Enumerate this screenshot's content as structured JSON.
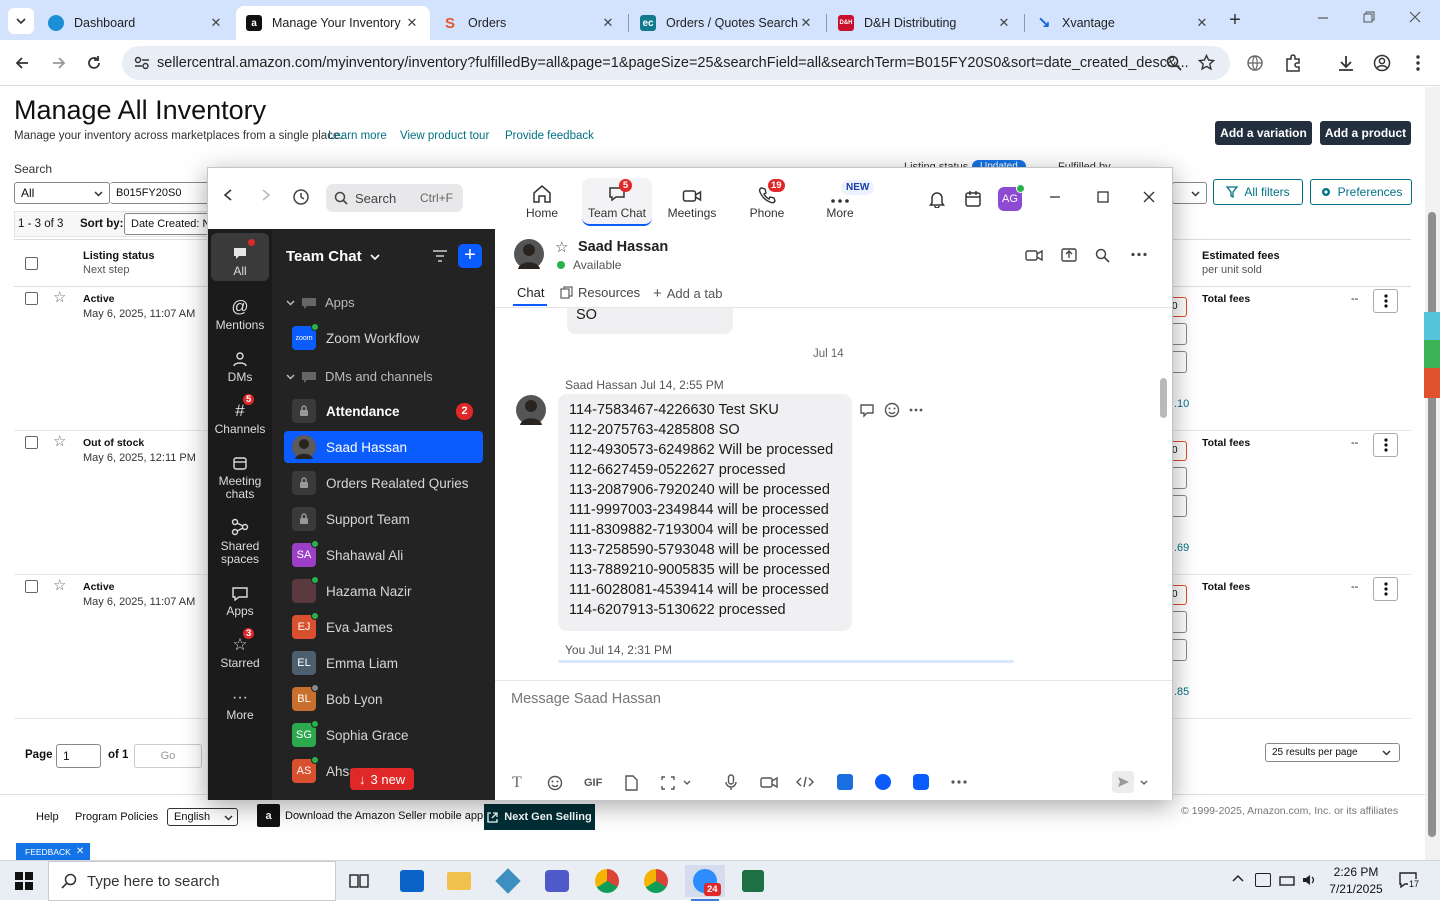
{
  "browser": {
    "tabs": [
      {
        "title": "Dashboard"
      },
      {
        "title": "Manage Your Inventory"
      },
      {
        "title": "Orders"
      },
      {
        "title": "Orders / Quotes Search"
      },
      {
        "title": "D&H Distributing"
      },
      {
        "title": "Xvantage"
      }
    ],
    "url": "sellercentral.amazon.com/myinventory/inventory?fulfilledBy=all&page=1&pageSize=25&searchField=all&searchTerm=B015FY20S0&sort=date_created_desc&..."
  },
  "amazon": {
    "title": "Manage All Inventory",
    "subtitle": "Manage your inventory across marketplaces from a single place.",
    "links": [
      "Learn more",
      "View product tour",
      "Provide feedback"
    ],
    "add_variation": "Add a variation",
    "add_product": "Add a product",
    "search_label": "Search",
    "search_scope": "All",
    "search_term": "B015FY20S0",
    "listing_status_partial": "Listing status",
    "updated_badge": "Updated",
    "fulfilled_by_partial": "Fulfilled by",
    "all_filters": "All filters",
    "preferences": "Preferences",
    "results_count": "1 - 3 of 3",
    "sort_by": "Sort by:",
    "sort_value": "Date Created: Ne",
    "col_listing_status": "Listing status",
    "col_next_step": "Next step",
    "col_est_fees": "Estimated fees",
    "col_per_unit": "per unit sold",
    "rows": [
      {
        "status": "Active",
        "date": "May 6, 2025, 11:07 AM",
        "fees": "Total fees",
        "dash": "--",
        "partial": ".10"
      },
      {
        "status": "Out of stock",
        "date": "May 6, 2025, 12:11 PM",
        "fees": "Total fees",
        "dash": "--",
        "partial": ".69"
      },
      {
        "status": "Active",
        "date": "May 6, 2025, 11:07 AM",
        "fees": "Total fees",
        "dash": "--",
        "partial": ".85"
      }
    ],
    "page_label": "Page",
    "page_value": "1",
    "of_label": "of 1",
    "go": "Go",
    "per_page": "25 results per page",
    "footer_help": "Help",
    "footer_policies": "Program Policies",
    "footer_lang": "English",
    "footer_app": "Download the Amazon Seller mobile app",
    "footer_ngs": "Next Gen Selling",
    "copyright": "© 1999-2025, Amazon.com, Inc. or its affiliates",
    "feedback": "FEEDBACK"
  },
  "zoom": {
    "search": "Search",
    "search_shortcut": "Ctrl+F",
    "tabs": [
      {
        "label": "Home",
        "badge": ""
      },
      {
        "label": "Team Chat",
        "badge": "5"
      },
      {
        "label": "Meetings",
        "badge": ""
      },
      {
        "label": "Phone",
        "badge": "19"
      },
      {
        "label": "More",
        "badge": "NEW"
      }
    ],
    "user_initials": "AG",
    "rail": [
      {
        "label": "All",
        "badge": ""
      },
      {
        "label": "Mentions",
        "badge": ""
      },
      {
        "label": "DMs",
        "badge": ""
      },
      {
        "label": "Channels",
        "badge": "5"
      },
      {
        "label": "Meeting chats",
        "badge": ""
      },
      {
        "label": "Shared spaces",
        "badge": ""
      },
      {
        "label": "Apps",
        "badge": ""
      },
      {
        "label": "Starred",
        "badge": "3"
      },
      {
        "label": "More",
        "badge": ""
      }
    ],
    "list_title": "Team Chat",
    "sections": {
      "apps": "Apps",
      "dms": "DMs and channels"
    },
    "zoom_app_logo": "zoom",
    "items": [
      {
        "name": "Zoom Workflow"
      },
      {
        "name": "Attendance",
        "badge": "2"
      },
      {
        "name": "Saad Hassan"
      },
      {
        "name": "Orders Realated Quries"
      },
      {
        "name": "Support Team"
      },
      {
        "name": "Shahawal Ali",
        "initials": "SA"
      },
      {
        "name": "Hazama Nazir"
      },
      {
        "name": "Eva James",
        "initials": "EJ"
      },
      {
        "name": "Emma Liam",
        "initials": "EL"
      },
      {
        "name": "Bob Lyon",
        "initials": "BL"
      },
      {
        "name": "Sophia Grace",
        "initials": "SG"
      },
      {
        "name": "Ahsa",
        "initials": "AS"
      }
    ],
    "new_pill": "3 new",
    "chat": {
      "contact": "Saad Hassan",
      "presence": "Available",
      "tab_chat": "Chat",
      "tab_resources": "Resources",
      "add_tab": "Add a tab",
      "prev_tail": "SO",
      "date_divider": "Jul 14",
      "sender_line": "Saad Hassan Jul 14, 2:55 PM",
      "lines": [
        "114-7583467-4226630 Test SKU",
        "112-2075763-4285808 SO",
        "112-4930573-6249862 Will be processed",
        "112-6627459-0522627 processed",
        "113-2087906-7920240 will be processed",
        "111-9997003-2349844 will be processed",
        "111-8309882-7193004 will be processed",
        "113-7258590-5793048 will be processed",
        "113-7889210-9005835 will be processed",
        "111-6028081-4539414 will be processed",
        "114-6207913-5130622 processed"
      ],
      "you_line": "You Jul 14, 2:31 PM",
      "composer_placeholder": "Message Saad Hassan",
      "gif": "GIF"
    }
  },
  "taskbar": {
    "search": "Type here to search",
    "time": "2:26 PM",
    "date": "7/21/2025",
    "notif_count": "17",
    "zoom_badge": "24"
  }
}
